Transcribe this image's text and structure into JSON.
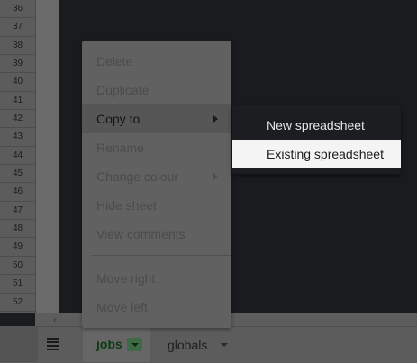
{
  "row_headers": [
    "36",
    "37",
    "38",
    "39",
    "40",
    "41",
    "42",
    "43",
    "44",
    "45",
    "46",
    "47",
    "48",
    "49",
    "50",
    "51",
    "52"
  ],
  "context_menu": {
    "items": [
      {
        "label": "Delete"
      },
      {
        "label": "Duplicate"
      },
      {
        "label": "Copy to"
      },
      {
        "label": "Rename"
      },
      {
        "label": "Change colour"
      },
      {
        "label": "Hide sheet"
      },
      {
        "label": "View comments"
      },
      {
        "label": "Move right"
      },
      {
        "label": "Move left"
      }
    ]
  },
  "submenu": {
    "items": [
      {
        "label": "New spreadsheet"
      },
      {
        "label": "Existing spreadsheet"
      }
    ]
  },
  "sheet_tabs": [
    {
      "label": "jobs",
      "active": true
    },
    {
      "label": "globals",
      "active": false
    }
  ],
  "colors": {
    "active_tab_text": "#0c3b14",
    "submenu_highlight": "#f4f4f5",
    "overlay_dim": "#616161"
  },
  "icons": {
    "all_sheets": "hamburger-icon",
    "submenu_arrow": "chevron-right-icon",
    "tab_dropdown": "caret-down-icon",
    "scroll_left": "chevron-left-icon"
  }
}
